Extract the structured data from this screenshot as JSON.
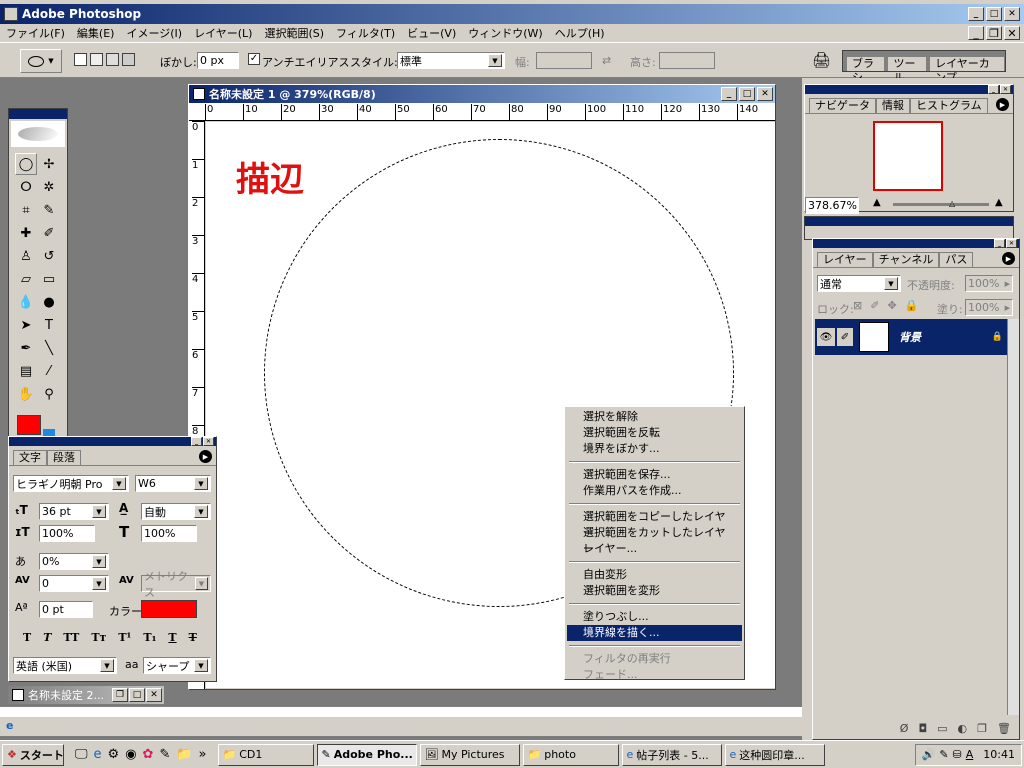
{
  "app_title": "Adobe Photoshop",
  "menubar": [
    "ファイル(F)",
    "編集(E)",
    "イメージ(I)",
    "レイヤー(L)",
    "選択範囲(S)",
    "フィルタ(T)",
    "ビュー(V)",
    "ウィンドウ(W)",
    "ヘルプ(H)"
  ],
  "options": {
    "feather_label": "ぼかし:",
    "feather_value": "0 px",
    "antialias_label": "アンチエイリアス",
    "style_label": "スタイル:",
    "style_value": "標準",
    "width_label": "幅:",
    "height_label": "高さ:",
    "palette_tabs": [
      "ブラシ",
      "ツール",
      "レイヤーカンプ"
    ]
  },
  "document": {
    "title": "名称未設定 1 @ 379%(RGB/8)",
    "text": "描辺",
    "ruler_h": [
      "0",
      "10",
      "20",
      "30",
      "40",
      "50",
      "60",
      "70",
      "80",
      "90",
      "100",
      "110",
      "120",
      "130",
      "140"
    ],
    "ruler_v": [
      "0",
      "1",
      "2",
      "3",
      "4",
      "5",
      "6",
      "7",
      "8"
    ]
  },
  "context_menu": {
    "items": [
      [
        "選択を解除",
        "選択範囲を反転",
        "境界をぼかす..."
      ],
      [
        "選択範囲を保存...",
        "作業用パスを作成..."
      ],
      [
        "選択範囲をコピーしたレイヤー",
        "選択範囲をカットしたレイヤー",
        "レイヤー..."
      ],
      [
        "自由変形",
        "選択範囲を変形"
      ],
      [
        "塗りつぶし...",
        "境界線を描く..."
      ],
      [
        "フィルタの再実行",
        "フェード..."
      ]
    ],
    "selected": "境界線を描く...",
    "disabled_group": 5
  },
  "character_panel": {
    "tabs": [
      "文字",
      "段落"
    ],
    "font": "ヒラギノ明朝 Pro",
    "weight": "W6",
    "size": "36 pt",
    "leading": "自動",
    "vscale": "100%",
    "hscale": "100%",
    "tracking_pct": "0%",
    "kerning": "0",
    "tracking": "メトリクス",
    "baseline": "0 pt",
    "color_label": "カラー:",
    "language": "英語 (米国)",
    "aa_label": "aa",
    "aa_value": "シャープ"
  },
  "minimized_doc": "名称未設定 2...",
  "navigator": {
    "tabs": [
      "ナビゲータ",
      "情報",
      "ヒストグラム"
    ],
    "zoom": "378.67%"
  },
  "layers": {
    "tabs": [
      "レイヤー",
      "チャンネル",
      "パス"
    ],
    "blend": "通常",
    "opacity_label": "不透明度:",
    "opacity": "100%",
    "lock_label": "ロック:",
    "fill_label": "塗り:",
    "fill": "100%",
    "layer_name": "背景"
  },
  "taskbar": {
    "start": "スタート",
    "buttons": [
      "CD1",
      "Adobe Pho...",
      "My Pictures",
      "photo",
      "帖子列表 - 5...",
      "这种圆印章..."
    ],
    "clock": "10:41"
  },
  "colors": {
    "accent": "#0a246a",
    "foreground": "#ff0000",
    "background": "#ffffff",
    "text_red": "#e01010"
  }
}
